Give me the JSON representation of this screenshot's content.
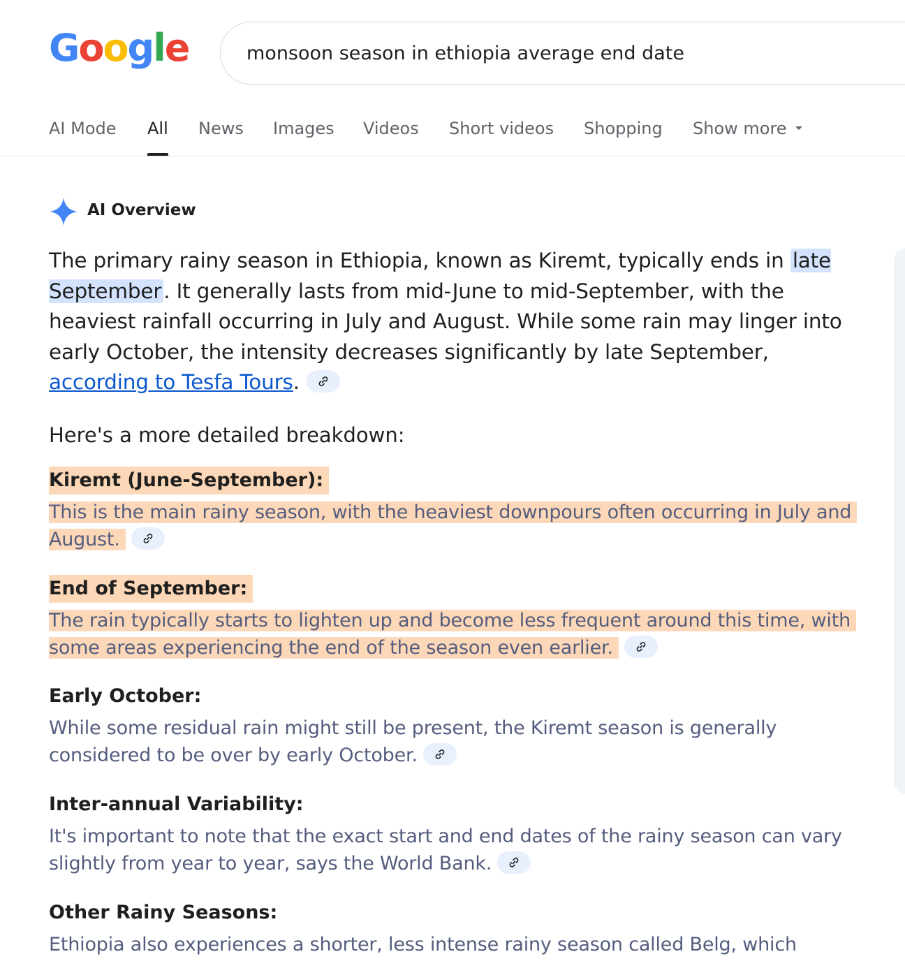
{
  "logo": {
    "letters": [
      "G",
      "o",
      "o",
      "g",
      "l",
      "e"
    ],
    "colors": [
      "#4285F4",
      "#EA4335",
      "#FBBC05",
      "#4285F4",
      "#34A853",
      "#EA4335"
    ]
  },
  "search": {
    "query": "monsoon season in ethiopia average end date"
  },
  "tabs": [
    {
      "label": "AI Mode",
      "active": false
    },
    {
      "label": "All",
      "active": true
    },
    {
      "label": "News",
      "active": false
    },
    {
      "label": "Images",
      "active": false
    },
    {
      "label": "Videos",
      "active": false
    },
    {
      "label": "Short videos",
      "active": false
    },
    {
      "label": "Shopping",
      "active": false
    },
    {
      "label": "Show more",
      "active": false
    }
  ],
  "ai_overview": {
    "title": "AI Overview",
    "accent_color": "#4285F4",
    "summary": {
      "part1": "The primary rainy season in Ethiopia, known as Kiremt, typically ends in ",
      "highlight": "late September",
      "part2": ". It generally lasts from mid-June to mid-September, with the heaviest rainfall occurring in July and August. While some rain may linger into early October, the intensity decreases significantly by late September, ",
      "source_link": "according to Tesfa Tours",
      "part3": "."
    },
    "breakdown_title": "Here's a more detailed breakdown:",
    "items": [
      {
        "heading": "Kiremt (June-September):",
        "body": "This is the main rainy season, with the heaviest downpours often occurring in July and August.",
        "highlighted": true
      },
      {
        "heading": "End of September:",
        "body": "The rain typically starts to lighten up and become less frequent around this time, with some areas experiencing the end of the season even earlier.",
        "highlighted": true
      },
      {
        "heading": "Early October:",
        "body": "While some residual rain might still be present, the Kiremt season is generally considered to be over by early October.",
        "highlighted": false
      },
      {
        "heading": "Inter-annual Variability:",
        "body": "It's important to note that the exact start and end dates of the rainy season can vary slightly from year to year, says the World Bank.",
        "highlighted": false
      },
      {
        "heading": "Other Rainy Seasons:",
        "body": "Ethiopia also experiences a shorter, less intense rainy season called Belg, which",
        "highlighted": false
      }
    ]
  },
  "colors": {
    "highlight_blue": "#d3e3fd",
    "highlight_orange": "#fdd8b8",
    "link": "#0b57d0"
  }
}
